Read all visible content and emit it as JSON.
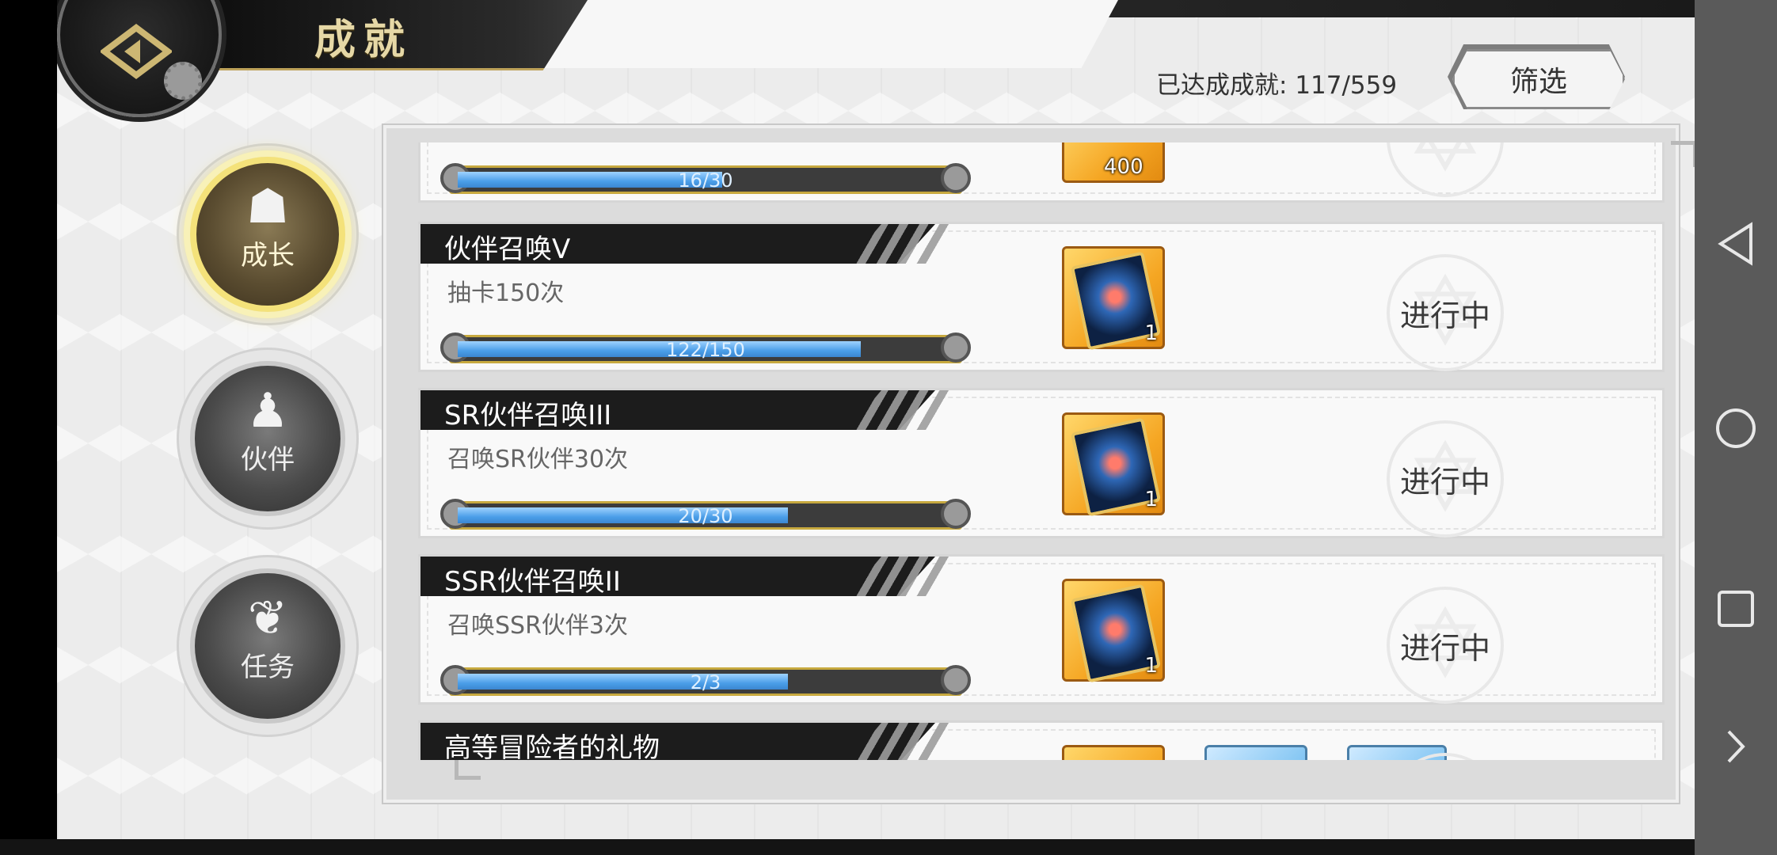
{
  "header": {
    "title": "成就",
    "achieved_label": "已达成成就:",
    "achieved_count": "117/559",
    "filter_label": "筛选"
  },
  "tabs": [
    {
      "label": "成长",
      "icon": "hooded-figure-icon",
      "active": true
    },
    {
      "label": "伙伴",
      "icon": "companions-icon",
      "active": false
    },
    {
      "label": "任务",
      "icon": "book-flame-icon",
      "active": false
    }
  ],
  "achievements": [
    {
      "title": "",
      "description": "",
      "progress_text": "16/30",
      "progress": 0.5333,
      "status": "",
      "reward_qty": "400"
    },
    {
      "title": "伙伴召唤V",
      "description": "抽卡150次",
      "progress_text": "122/150",
      "progress": 0.8133,
      "status": "进行中",
      "reward_qty": "1"
    },
    {
      "title": "SR伙伴召唤III",
      "description": "召唤SR伙伴30次",
      "progress_text": "20/30",
      "progress": 0.6667,
      "status": "进行中",
      "reward_qty": "1"
    },
    {
      "title": "SSR伙伴召唤II",
      "description": "召唤SSR伙伴3次",
      "progress_text": "2/3",
      "progress": 0.6667,
      "status": "进行中",
      "reward_qty": "1"
    },
    {
      "title": "高等冒险者的礼物",
      "description": "",
      "progress_text": "",
      "progress": 0,
      "status": "",
      "reward_qty": ""
    }
  ],
  "colors": {
    "accent_gold": "#f4e27a",
    "progress_blue": "#4a9ee8",
    "title_bar": "#1c1c1c"
  }
}
